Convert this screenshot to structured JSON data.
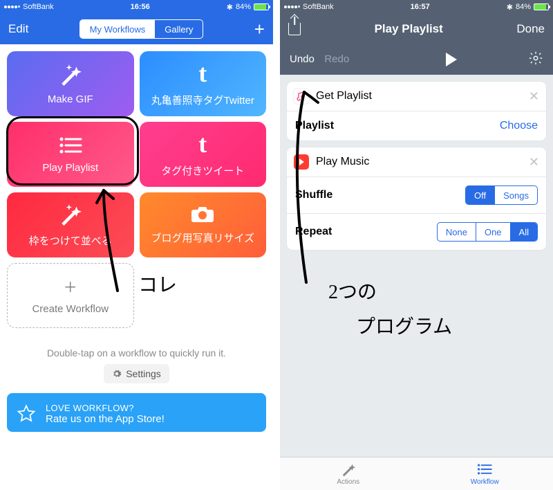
{
  "status": {
    "carrier": "SoftBank",
    "time_left": "16:56",
    "time_right": "16:57",
    "battery_pct": "84%"
  },
  "left": {
    "edit": "Edit",
    "segments": {
      "mine": "My Workflows",
      "gallery": "Gallery"
    },
    "tiles": {
      "make_gif": "Make GIF",
      "tumblr_tw": "丸亀善照寺タグTwitter",
      "play_playlist": "Play Playlist",
      "tag_tweet": "タグ付きツイート",
      "frame": "枠をつけて並べる",
      "photo": "ブログ用写真リサイズ",
      "create": "Create Workflow"
    },
    "tip": "Double-tap on a workflow to quickly run it.",
    "settings": "Settings",
    "promo": {
      "title": "LOVE WORKFLOW?",
      "sub": "Rate us on the App Store!"
    },
    "hand_label": "コレ"
  },
  "right": {
    "title": "Play Playlist",
    "done": "Done",
    "undo": "Undo",
    "redo": "Redo",
    "get_playlist": {
      "head": "Get Playlist",
      "row_label": "Playlist",
      "choose": "Choose"
    },
    "play_music": {
      "head": "Play Music",
      "shuffle_label": "Shuffle",
      "shuffle_opts": {
        "off": "Off",
        "songs": "Songs"
      },
      "repeat_label": "Repeat",
      "repeat_opts": {
        "none": "None",
        "one": "One",
        "all": "All"
      }
    },
    "tabs": {
      "actions": "Actions",
      "workflow": "Workflow"
    },
    "hand_line1": "2つの",
    "hand_line2": "プログラム"
  }
}
